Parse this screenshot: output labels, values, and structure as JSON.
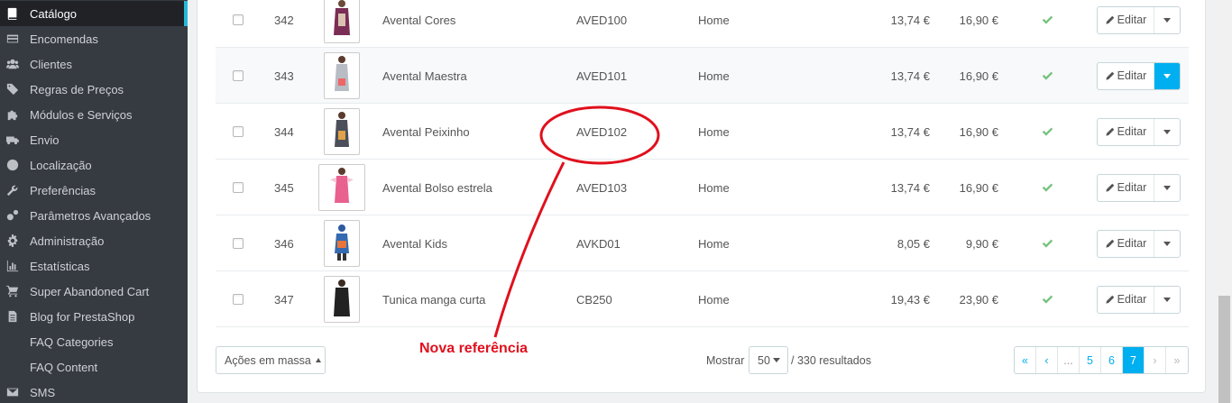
{
  "sidebar": {
    "items": [
      {
        "label": "Catálogo",
        "icon": "book-icon"
      },
      {
        "label": "Encomendas",
        "icon": "credit-card-icon"
      },
      {
        "label": "Clientes",
        "icon": "users-icon"
      },
      {
        "label": "Regras de Preços",
        "icon": "tags-icon"
      },
      {
        "label": "Módulos e Serviços",
        "icon": "puzzle-icon"
      },
      {
        "label": "Envio",
        "icon": "truck-icon"
      },
      {
        "label": "Localização",
        "icon": "globe-icon"
      },
      {
        "label": "Preferências",
        "icon": "wrench-icon"
      },
      {
        "label": "Parâmetros Avançados",
        "icon": "cogs-icon"
      },
      {
        "label": "Administração",
        "icon": "gear-icon"
      },
      {
        "label": "Estatísticas",
        "icon": "bar-chart-icon"
      },
      {
        "label": "Super Abandoned Cart",
        "icon": "cart-icon"
      },
      {
        "label": "Blog for PrestaShop",
        "icon": "document-icon"
      },
      {
        "label": "FAQ Categories",
        "icon": ""
      },
      {
        "label": "FAQ Content",
        "icon": ""
      },
      {
        "label": "SMS",
        "icon": "envelope-icon"
      }
    ]
  },
  "table": {
    "rows": [
      {
        "id": "342",
        "name": "Avental Cores",
        "reference": "AVED100",
        "category": "Home",
        "price_excl": "13,74 €",
        "price_incl": "16,90 €",
        "active": true
      },
      {
        "id": "343",
        "name": "Avental Maestra",
        "reference": "AVED101",
        "category": "Home",
        "price_excl": "13,74 €",
        "price_incl": "16,90 €",
        "active": true
      },
      {
        "id": "344",
        "name": "Avental Peixinho",
        "reference": "AVED102",
        "category": "Home",
        "price_excl": "13,74 €",
        "price_incl": "16,90 €",
        "active": true
      },
      {
        "id": "345",
        "name": "Avental Bolso estrela",
        "reference": "AVED103",
        "category": "Home",
        "price_excl": "13,74 €",
        "price_incl": "16,90 €",
        "active": true
      },
      {
        "id": "346",
        "name": "Avental Kids",
        "reference": "AVKD01",
        "category": "Home",
        "price_excl": "8,05 €",
        "price_incl": "9,90 €",
        "active": true
      },
      {
        "id": "347",
        "name": "Tunica manga curta",
        "reference": "CB250",
        "category": "Home",
        "price_excl": "19,43 €",
        "price_incl": "23,90 €",
        "active": true
      }
    ],
    "edit_label": "Editar"
  },
  "footer": {
    "bulk_label": "Ações em massa",
    "show_label": "Mostrar",
    "per_page": "50",
    "results": "/ 330 resultados",
    "pagination": [
      "«",
      "‹",
      "...",
      "5",
      "6",
      "7",
      "›",
      "»"
    ],
    "current_page": "7"
  },
  "annotation": {
    "label": "Nova referência",
    "color": "#e0101d"
  },
  "colors": {
    "accent": "#00aff0",
    "sidebar_bg": "#363a41",
    "active_check": "#72c279"
  }
}
